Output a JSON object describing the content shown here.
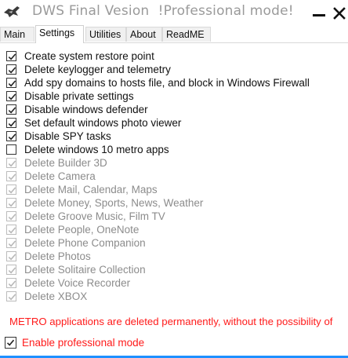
{
  "window": {
    "title": "DWS Final Vesion  !Professional mode!",
    "icon": "app-logo-icon",
    "minimize_icon": "minimize-icon",
    "close_icon": "close-icon"
  },
  "tabs": [
    {
      "label": "Main",
      "active": false
    },
    {
      "label": "Settings",
      "active": true
    },
    {
      "label": "Utilities",
      "active": false
    },
    {
      "label": "About",
      "active": false
    },
    {
      "label": "ReadME",
      "active": false
    }
  ],
  "settings": {
    "options": [
      {
        "label": "Create system restore point",
        "checked": true,
        "enabled": true
      },
      {
        "label": "Delete keylogger and telemetry",
        "checked": true,
        "enabled": true
      },
      {
        "label": "Add spy domains to hosts file, and block in Windows Firewall",
        "checked": true,
        "enabled": true
      },
      {
        "label": "Disable private settings",
        "checked": true,
        "enabled": true
      },
      {
        "label": "Disable windows defender",
        "checked": true,
        "enabled": true
      },
      {
        "label": "Set default windows photo viewer",
        "checked": true,
        "enabled": true
      },
      {
        "label": "Disable SPY tasks",
        "checked": true,
        "enabled": true
      },
      {
        "label": "Delete windows 10 metro apps",
        "checked": false,
        "enabled": true
      },
      {
        "label": "Delete Builder 3D",
        "checked": true,
        "enabled": false
      },
      {
        "label": "Delete Camera",
        "checked": true,
        "enabled": false
      },
      {
        "label": "Delete Mail, Calendar, Maps",
        "checked": true,
        "enabled": false
      },
      {
        "label": "Delete Money, Sports, News, Weather",
        "checked": true,
        "enabled": false
      },
      {
        "label": "Delete Groove Music, Film TV",
        "checked": true,
        "enabled": false
      },
      {
        "label": "Delete People, OneNote",
        "checked": true,
        "enabled": false
      },
      {
        "label": "Delete Phone Companion",
        "checked": true,
        "enabled": false
      },
      {
        "label": "Delete Photos",
        "checked": true,
        "enabled": false
      },
      {
        "label": "Delete Solitaire Collection",
        "checked": true,
        "enabled": false
      },
      {
        "label": "Delete Voice Recorder",
        "checked": true,
        "enabled": false
      },
      {
        "label": "Delete XBOX",
        "checked": true,
        "enabled": false
      }
    ],
    "warning_text": "METRO applications are deleted permanently, without the possibility of",
    "professional_mode": {
      "label": "Enable professional mode",
      "checked": true
    }
  },
  "colors": {
    "warning": "#ff1a1a",
    "accent": "#1e90ff",
    "disabled_text": "#8c8c8c"
  }
}
